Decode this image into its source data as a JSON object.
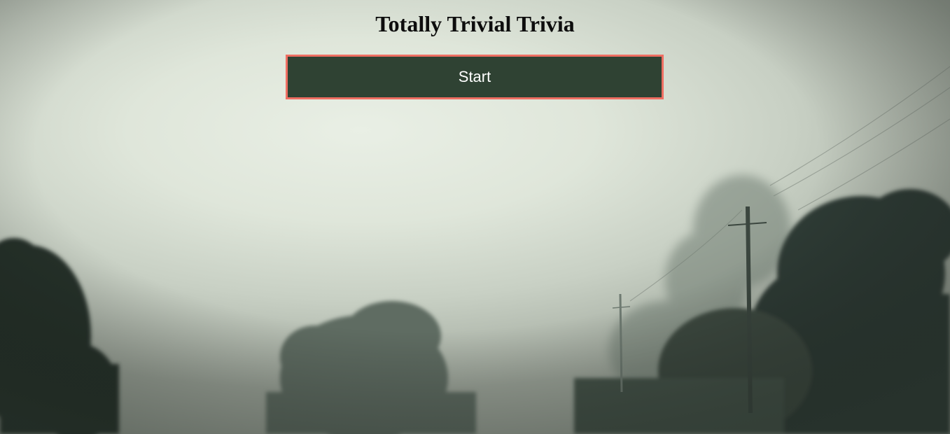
{
  "page": {
    "title": "Totally Trivial Trivia"
  },
  "controls": {
    "start_label": "Start"
  },
  "colors": {
    "button_fill": "#2f4233",
    "button_border": "#ef6e62",
    "title_text": "#0d0d0d",
    "fog": "#e9efe5",
    "trees": "#2e3a33"
  },
  "background": {
    "icon": "foggy-landscape-photo"
  }
}
